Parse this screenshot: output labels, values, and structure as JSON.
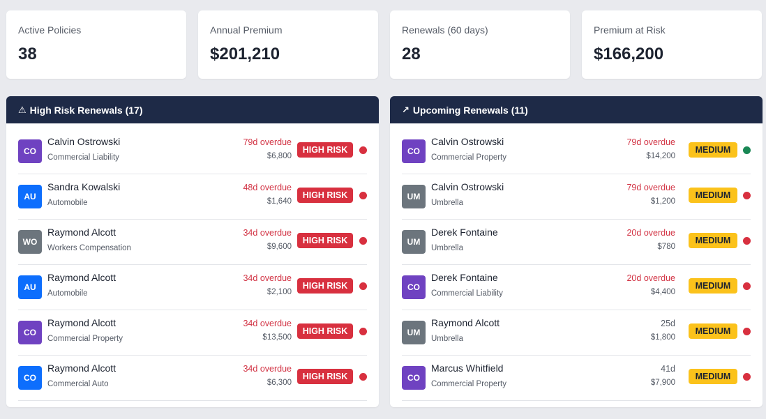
{
  "stats": [
    {
      "label": "Active Policies",
      "value": "38"
    },
    {
      "label": "Annual Premium",
      "value": "$201,210"
    },
    {
      "label": "Renewals (60 days)",
      "value": "28"
    },
    {
      "label": "Premium at Risk",
      "value": "$166,200"
    }
  ],
  "colors": {
    "header": "#1e2a47",
    "avatar_purple": "#6f42c1",
    "avatar_blue": "#0d6efd",
    "avatar_gray": "#6c757d",
    "risk_red": "#d8303f",
    "medium_yellow": "#fbc21b",
    "status_green": "#198754"
  },
  "high_risk": {
    "icon": "warning-icon",
    "icon_glyph": "⚠",
    "title": "High Risk Renewals (17)",
    "rows": [
      {
        "initials": "CO",
        "avatar_color": "purple",
        "name": "Calvin Ostrowski",
        "type": "Commercial Liability",
        "due": "79d overdue",
        "overdue": true,
        "amount": "$6,800",
        "badge": "HIGH RISK",
        "status": "red"
      },
      {
        "initials": "AU",
        "avatar_color": "blue",
        "name": "Sandra Kowalski",
        "type": "Automobile",
        "due": "48d overdue",
        "overdue": true,
        "amount": "$1,640",
        "badge": "HIGH RISK",
        "status": "red"
      },
      {
        "initials": "WO",
        "avatar_color": "gray",
        "name": "Raymond Alcott",
        "type": "Workers Compensation",
        "due": "34d overdue",
        "overdue": true,
        "amount": "$9,600",
        "badge": "HIGH RISK",
        "status": "red"
      },
      {
        "initials": "AU",
        "avatar_color": "blue",
        "name": "Raymond Alcott",
        "type": "Automobile",
        "due": "34d overdue",
        "overdue": true,
        "amount": "$2,100",
        "badge": "HIGH RISK",
        "status": "red"
      },
      {
        "initials": "CO",
        "avatar_color": "purple",
        "name": "Raymond Alcott",
        "type": "Commercial Property",
        "due": "34d overdue",
        "overdue": true,
        "amount": "$13,500",
        "badge": "HIGH RISK",
        "status": "red"
      },
      {
        "initials": "CO",
        "avatar_color": "blue",
        "name": "Raymond Alcott",
        "type": "Commercial Auto",
        "due": "34d overdue",
        "overdue": true,
        "amount": "$6,300",
        "badge": "HIGH RISK",
        "status": "red"
      }
    ]
  },
  "upcoming": {
    "icon": "trend-up-icon",
    "icon_glyph": "↗",
    "title": "Upcoming Renewals (11)",
    "rows": [
      {
        "initials": "CO",
        "avatar_color": "purple",
        "name": "Calvin Ostrowski",
        "type": "Commercial Property",
        "due": "79d overdue",
        "overdue": true,
        "amount": "$14,200",
        "badge": "MEDIUM",
        "status": "green"
      },
      {
        "initials": "UM",
        "avatar_color": "gray",
        "name": "Calvin Ostrowski",
        "type": "Umbrella",
        "due": "79d overdue",
        "overdue": true,
        "amount": "$1,200",
        "badge": "MEDIUM",
        "status": "red"
      },
      {
        "initials": "UM",
        "avatar_color": "gray",
        "name": "Derek Fontaine",
        "type": "Umbrella",
        "due": "20d overdue",
        "overdue": true,
        "amount": "$780",
        "badge": "MEDIUM",
        "status": "red"
      },
      {
        "initials": "CO",
        "avatar_color": "purple",
        "name": "Derek Fontaine",
        "type": "Commercial Liability",
        "due": "20d overdue",
        "overdue": true,
        "amount": "$4,400",
        "badge": "MEDIUM",
        "status": "red"
      },
      {
        "initials": "UM",
        "avatar_color": "gray",
        "name": "Raymond Alcott",
        "type": "Umbrella",
        "due": "25d",
        "overdue": false,
        "amount": "$1,800",
        "badge": "MEDIUM",
        "status": "red"
      },
      {
        "initials": "CO",
        "avatar_color": "purple",
        "name": "Marcus Whitfield",
        "type": "Commercial Property",
        "due": "41d",
        "overdue": false,
        "amount": "$7,900",
        "badge": "MEDIUM",
        "status": "red"
      }
    ]
  }
}
